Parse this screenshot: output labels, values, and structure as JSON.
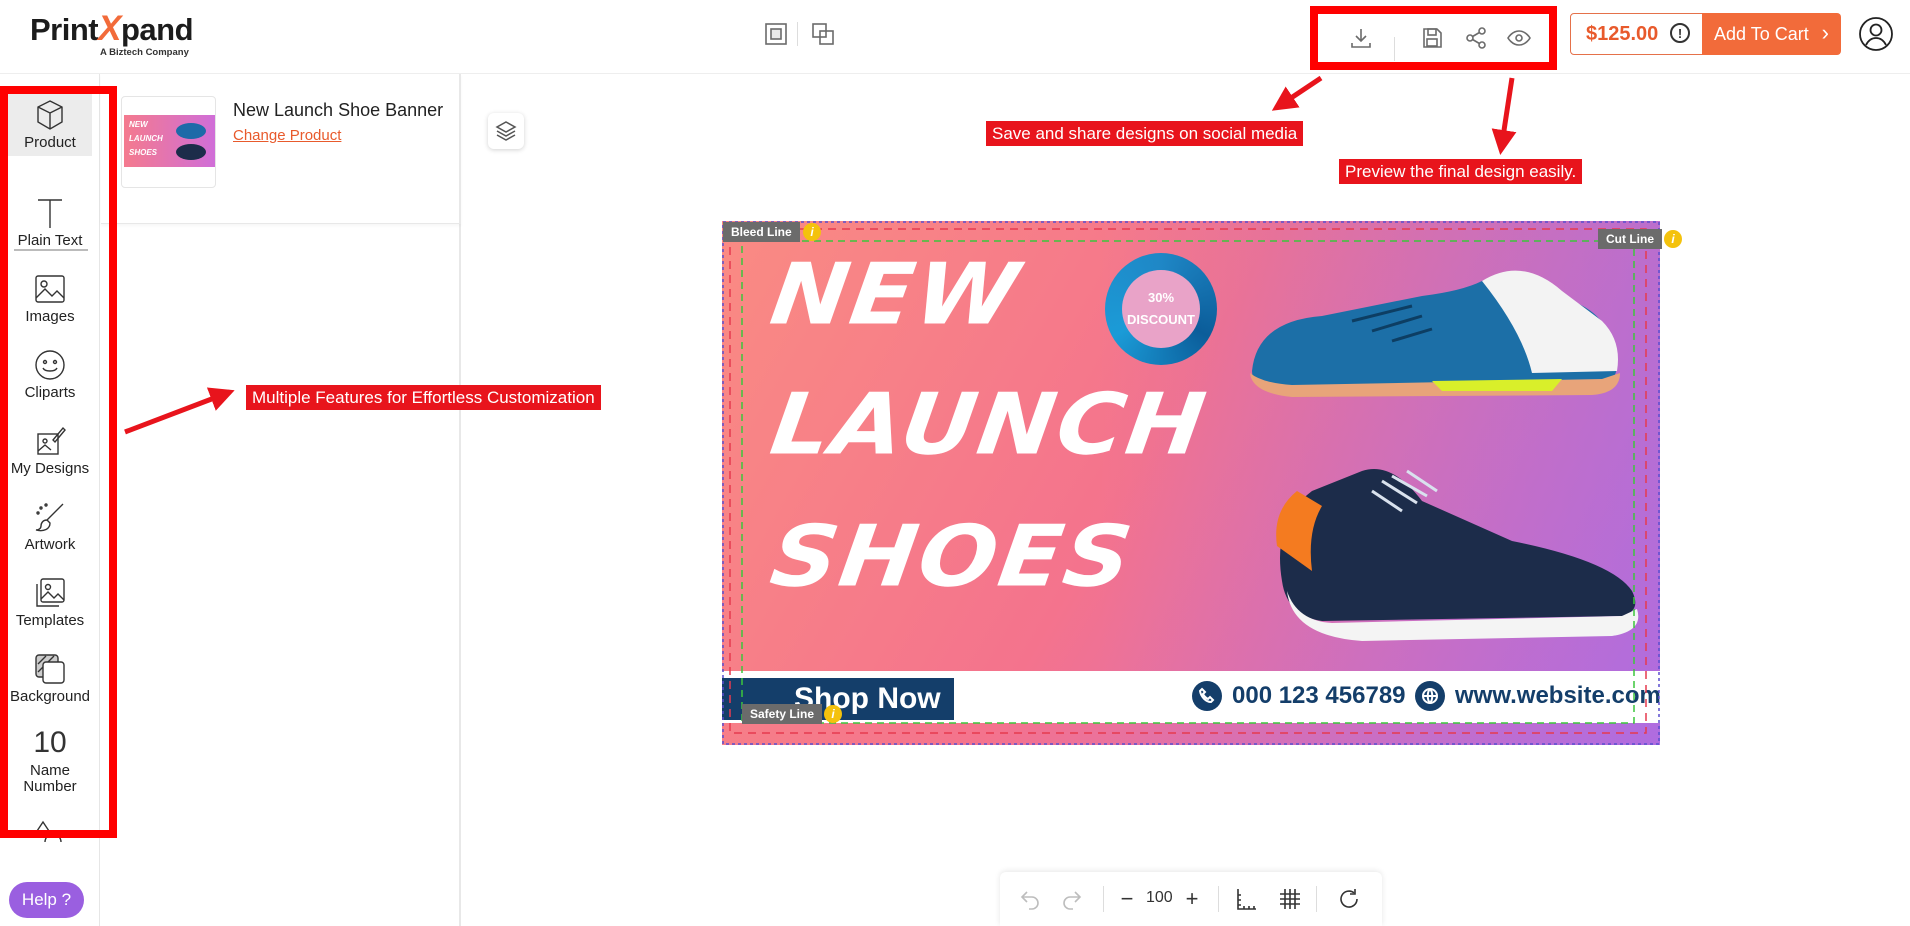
{
  "app": {
    "brand_prefix": "Print",
    "brand_x": "X",
    "brand_suffix": "pand",
    "tagline": "A Biztech Company"
  },
  "header": {
    "price": "$125.00",
    "price_info_glyph": "!",
    "add_to_cart_label": "Add To Cart",
    "add_to_cart_chevron": "›",
    "icons": [
      "layers-front-icon",
      "layers-back-icon",
      "download-icon",
      "save-icon",
      "share-icon",
      "preview-eye-icon",
      "user-account-icon"
    ]
  },
  "sidebar": {
    "items": [
      {
        "label": "Product",
        "icon": "cube-icon"
      },
      {
        "label": "Plain Text",
        "icon": "text-t-icon"
      },
      {
        "label": "Images",
        "icon": "image-icon"
      },
      {
        "label": "Cliparts",
        "icon": "smiley-icon"
      },
      {
        "label": "My Designs",
        "icon": "my-designs-icon"
      },
      {
        "label": "Artwork",
        "icon": "artwork-brush-icon"
      },
      {
        "label": "Templates",
        "icon": "templates-icon"
      },
      {
        "label": "Background",
        "icon": "background-icon"
      },
      {
        "label": "Name Number",
        "glyph": "10",
        "label_line1": "Name",
        "label_line2": "Number"
      }
    ],
    "help_label": "Help ?"
  },
  "product_panel": {
    "title": "New Launch Shoe Banner",
    "change_link": "Change Product",
    "thumb_lines": [
      "NEW",
      "LAUNCH",
      "SHOES"
    ]
  },
  "design": {
    "line1": "NEW",
    "line2": "LAUNCH",
    "line3": "SHOES",
    "discount_line1": "30%",
    "discount_line2": "DISCOUNT",
    "cta": "Shop Now",
    "phone": "000 123 456789",
    "website": "www.website.com",
    "guides": {
      "bleed": "Bleed Line",
      "cut": "Cut Line",
      "safety": "Safety Line",
      "info_glyph": "i"
    }
  },
  "bottom_toolbar": {
    "zoom_value": "100",
    "zoom_minus": "−",
    "zoom_plus": "+"
  },
  "annotations": {
    "save_share": "Save and share designs on social media",
    "preview": "Preview the final design easily.",
    "features": "Multiple Features for Effortless Customization"
  },
  "colors": {
    "accent": "#f26b3a",
    "annotation_red": "#e8141c",
    "help_purple": "#9a5fe0",
    "navy": "#143e6a"
  }
}
